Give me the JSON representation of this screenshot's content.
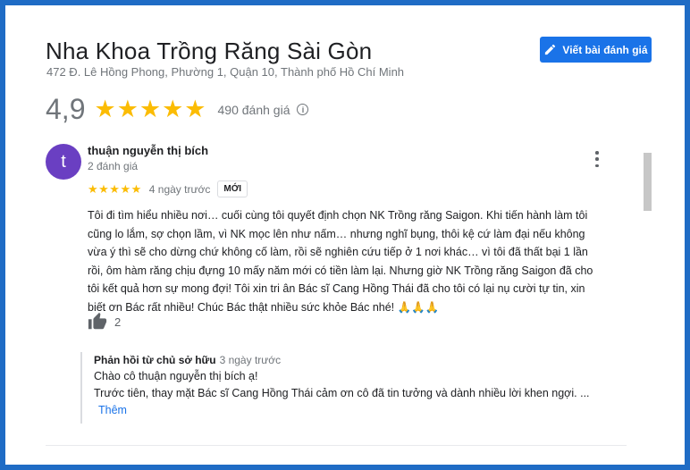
{
  "business": {
    "name": "Nha Khoa Trồng Răng Sài Gòn",
    "address": "472 Đ. Lê Hồng Phong, Phường 1, Quận 10, Thành phố Hồ Chí Minh"
  },
  "write_review_label": "Viết bài đánh giá",
  "rating": {
    "value": "4,9",
    "stars": "★★★★★",
    "count_label": "490 đánh giá"
  },
  "review": {
    "avatar_letter": "t",
    "author": "thuận nguyễn thị bích",
    "author_meta": "2 đánh giá",
    "stars": "★★★★★",
    "time": "4 ngày trước",
    "badge": "MỚI",
    "lines": [
      "Tôi đi tìm hiểu nhiều nơi… cuối cùng tôi quyết định chọn NK Trồng răng Saigon. Khi tiến hành làm tôi",
      "cũng lo lắm, sợ chọn lầm, vì NK mọc lên như nấm… nhưng nghĩ bụng, thôi kệ cứ làm đại nếu không",
      "vừa ý thì sẽ cho dừng chứ không cố làm, rồi sẽ nghiên cứu tiếp ở 1 nơi khác… vì tôi đã thất bại 1 lần",
      "rồi, ôm hàm răng chịu đựng 10 mấy năm mới có tiền làm lại. Nhưng giờ NK Trồng răng Saigon đã cho",
      "tôi kết quả hơn sự mong đợi! Tôi xin tri ân Bác sĩ Cang Hồng Thái đã cho tôi có lại nụ cười tự tin, xin",
      "biết ơn Bác rất nhiều! Chúc Bác thật nhiều sức khỏe Bác nhé! 🙏🙏🙏"
    ],
    "likes": "2"
  },
  "owner_reply": {
    "label": "Phản hồi từ chủ sở hữu",
    "time": "3 ngày trước",
    "line1": "Chào cô thuận nguyễn thị bích ạ!",
    "line2": "Trước tiên, thay mặt Bác sĩ Cang Hồng Thái cảm ơn cô đã tin tưởng và dành nhiều lời khen ngợi. ...",
    "more_label": "Thêm"
  },
  "colors": {
    "frame": "#1f6cc5",
    "accent": "#1a73e8",
    "star": "#fbbc04",
    "avatar": "#6a3fc2"
  },
  "icons": [
    "edit-pencil-icon",
    "star-icon",
    "info-icon",
    "more-vert-icon",
    "thumb-up-icon"
  ]
}
